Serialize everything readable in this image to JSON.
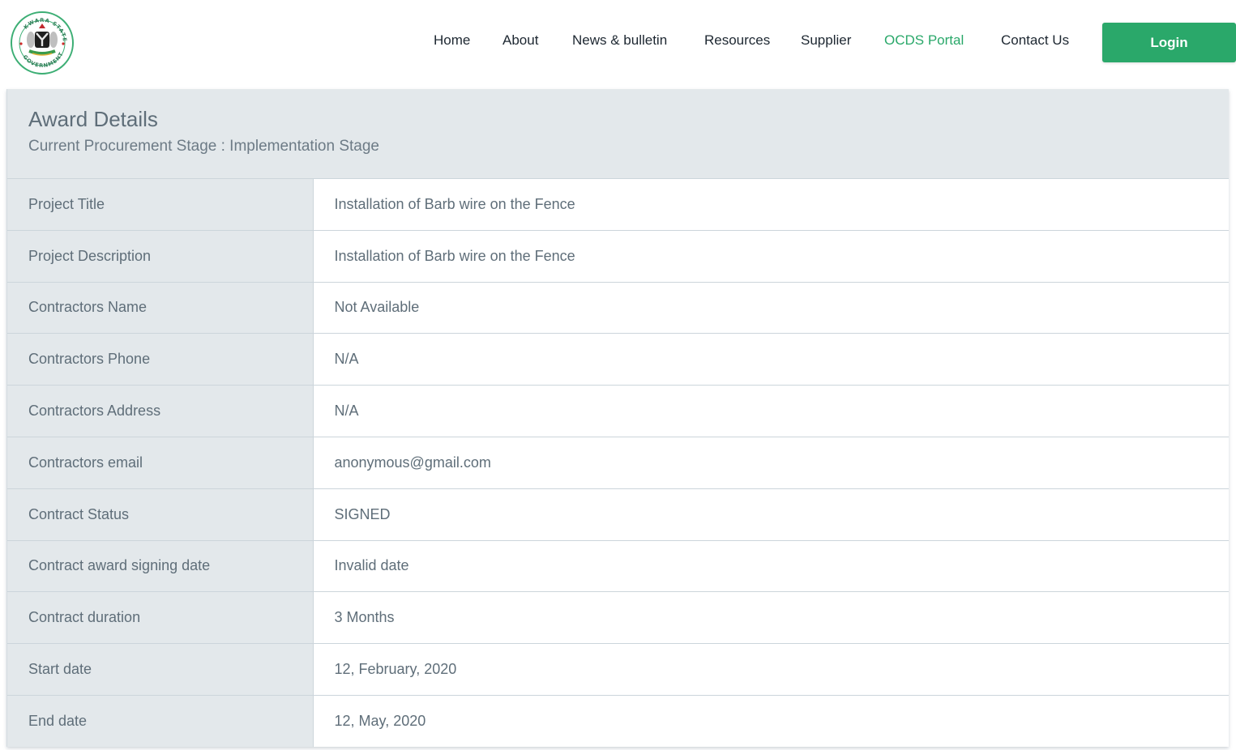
{
  "header": {
    "logo": {
      "icon": "kwara-state-government-seal-icon",
      "top_text": "KWARA STATE",
      "bottom_text": "GOVERNMENT"
    },
    "nav": [
      {
        "label": "Home",
        "active": false
      },
      {
        "label": "About",
        "active": false
      },
      {
        "label": "News & bulletin",
        "active": false
      },
      {
        "label": "Resources",
        "active": false
      },
      {
        "label": "Supplier",
        "active": false
      },
      {
        "label": "OCDS Portal",
        "active": true
      },
      {
        "label": "Contact Us",
        "active": false
      }
    ],
    "login_label": "Login"
  },
  "colors": {
    "accent": "#2aa86a",
    "panel_bg": "#e3e8eb",
    "text": "#5f6e79"
  },
  "award": {
    "title": "Award Details",
    "stage": "Current Procurement Stage : Implementation Stage",
    "rows": [
      {
        "label": "Project Title",
        "value": "Installation of Barb wire on the Fence"
      },
      {
        "label": "Project Description",
        "value": "Installation of Barb wire on the Fence"
      },
      {
        "label": "Contractors Name",
        "value": "Not Available"
      },
      {
        "label": "Contractors Phone",
        "value": "N/A"
      },
      {
        "label": "Contractors Address",
        "value": "N/A"
      },
      {
        "label": "Contractors email",
        "value": "anonymous@gmail.com"
      },
      {
        "label": "Contract Status",
        "value": "SIGNED"
      },
      {
        "label": "Contract award signing date",
        "value": "Invalid date"
      },
      {
        "label": "Contract duration",
        "value": "3 Months"
      },
      {
        "label": "Start date",
        "value": "12, February, 2020"
      },
      {
        "label": "End date",
        "value": "12, May, 2020"
      }
    ]
  }
}
